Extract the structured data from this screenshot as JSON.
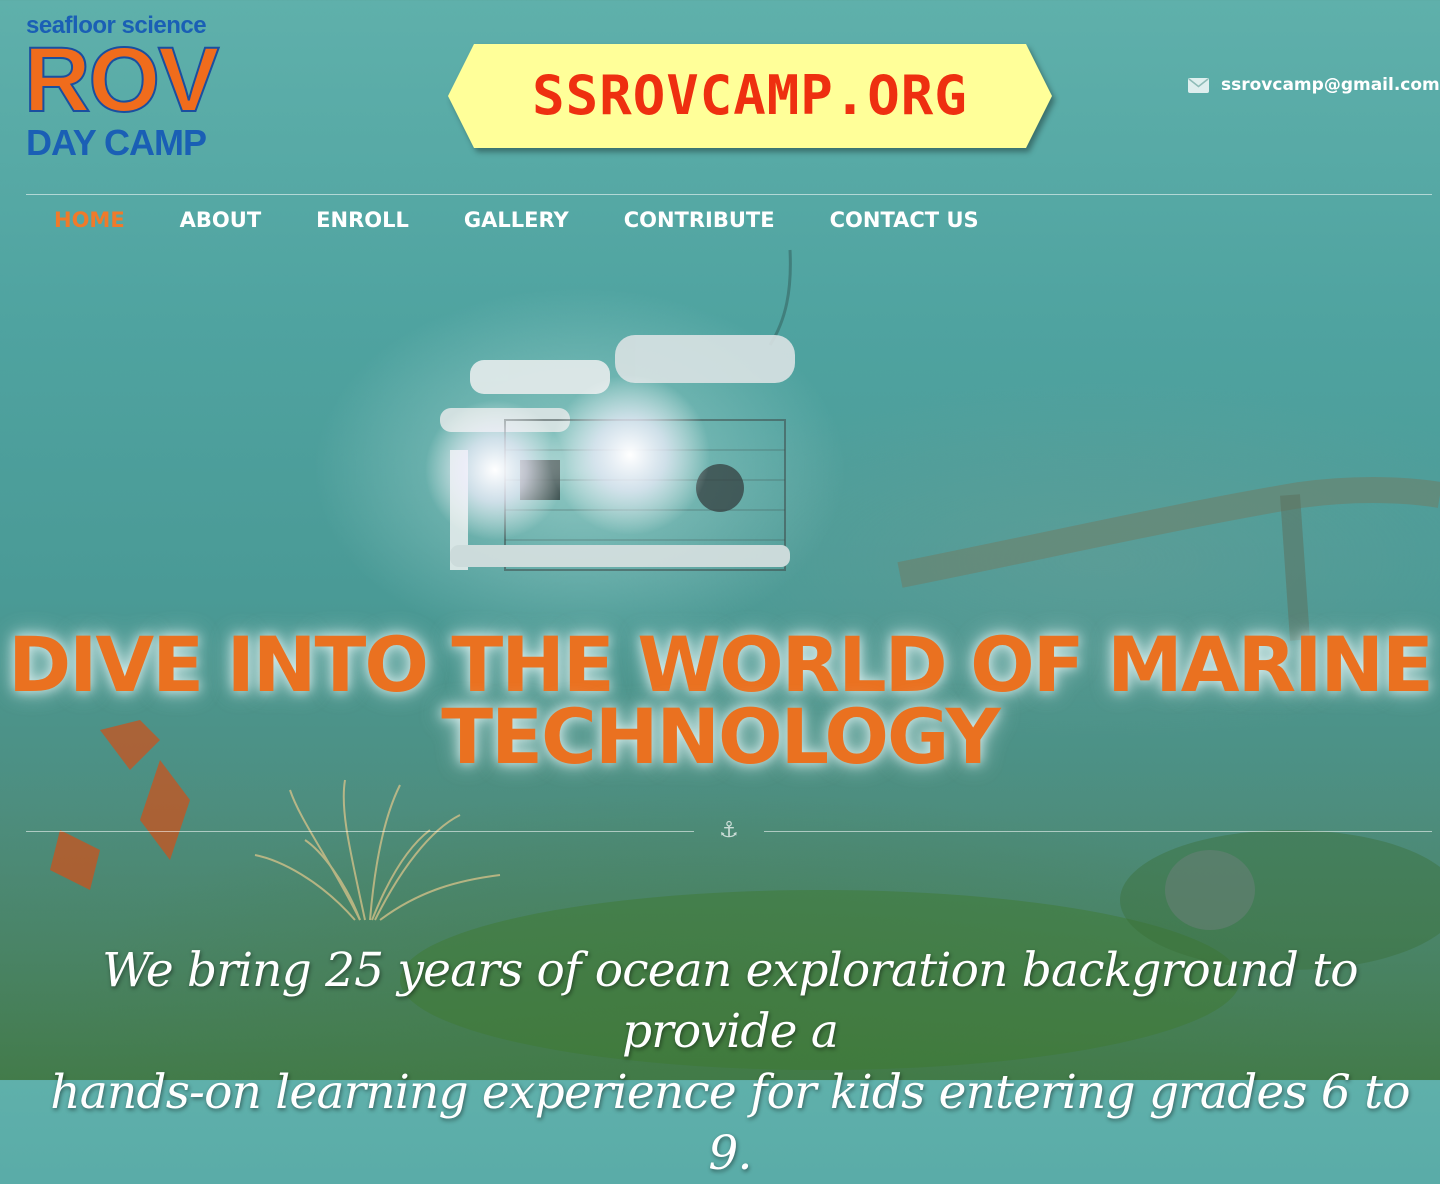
{
  "logo": {
    "top_text": "seafloor science",
    "main_text": "ROV",
    "bottom_text": "DAY CAMP"
  },
  "banner": {
    "text": "SSROVCAMP.ORG"
  },
  "header": {
    "email": "ssrovcamp@gmail.com",
    "email_icon": "envelope-icon"
  },
  "nav": {
    "items": [
      {
        "label": "HOME",
        "active": true
      },
      {
        "label": "ABOUT"
      },
      {
        "label": "ENROLL"
      },
      {
        "label": "GALLERY"
      },
      {
        "label": "CONTRIBUTE"
      },
      {
        "label": "CONTACT US"
      }
    ]
  },
  "hero": {
    "title_line1": "DIVE INTO THE WORLD OF MARINE",
    "title_line2": "TECHNOLOGY",
    "divider_icon": "anchor-icon",
    "tagline_line1": "We bring 25 years of ocean exploration background to provide a",
    "tagline_line2": "hands-on learning experience for kids entering grades 6 to 9."
  },
  "colors": {
    "accent_orange": "#ea7120",
    "banner_yellow": "#ffff99",
    "banner_text": "#ee2f10",
    "logo_blue": "#1a5fb5"
  }
}
